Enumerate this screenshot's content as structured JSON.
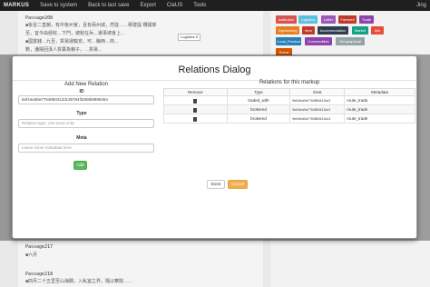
{
  "nav": {
    "brand": "MARKUS",
    "items": [
      "Save to system",
      "Back to last save",
      "Export",
      "ClaUS",
      "Tools"
    ],
    "user": "Jing"
  },
  "background": {
    "passages": [
      {
        "title": "Passage208",
        "text": "■後晉二直朝，有中後州官，且有兩州城，然從……"
      },
      {
        "title": "Passage217",
        "text": "■六月"
      },
      {
        "title": "Passage218",
        "text": "■四月二十五里至山海關，入私室之界，隨以察院……"
      }
    ],
    "lines": [
      "■後晉二直朝，有中後州官，且有兩州城，然從……穆建提 柵開禁",
      "至，宜今由經收…下門，總勢在兵…遣事總會上…",
      "■國賞錢…九至，貿易運輸安，可…縣西…商…",
      "數，潘陽回漢人貿賣為粮子，…貿易…",
      "■二十日，貿易將運隊遷業之東地去…",
      "■東…二…"
    ],
    "popup_label": "Logistics S"
  },
  "tags": [
    {
      "label": "Institution",
      "color": "#d9534f"
    },
    {
      "label": "Logistics",
      "color": "#5bc0de"
    },
    {
      "label": "Letter",
      "color": "#9b59b6"
    },
    {
      "label": "Farewell",
      "color": "#c0392b"
    },
    {
      "label": "Trade",
      "color": "#8e44ad"
    },
    {
      "label": "Sightseeing",
      "color": "#e67e22"
    },
    {
      "label": "Item",
      "color": "#c0392b"
    },
    {
      "label": "Accommodation",
      "color": "#2c3e50"
    },
    {
      "label": "Market",
      "color": "#16a085"
    },
    {
      "label": "Attr",
      "color": "#e74c3c"
    },
    {
      "label": "Local_Product",
      "color": "#2980b9"
    },
    {
      "label": "Commodities",
      "color": "#8e44ad"
    },
    {
      "label": "Geographical",
      "color": "#95a5a6"
    },
    {
      "label": "Event",
      "color": "#d35400"
    }
  ],
  "dialog": {
    "title": "Relations Dialog",
    "add_title": "Add New Relation",
    "id_label": "ID",
    "id_value": "5ef44ed9a7764850412dc35784f3058b8898464",
    "type_label": "Type",
    "type_placeholder": "Relation-type, one word only!",
    "meta_label": "Meta",
    "meta_placeholder": "Leave some metadata here",
    "add_button": "Add",
    "table_title": "Relations for this markup",
    "columns": [
      "Remove",
      "Type",
      "Dest",
      "Metadata"
    ],
    "rows": [
      {
        "type": "traded_with",
        "dest": "5ef44ed9a7764850412dc3",
        "meta": "route_trade"
      },
      {
        "type": "brokered",
        "dest": "5ef44ed9a7764850412dc3",
        "meta": "route_trade"
      },
      {
        "type": "brokered",
        "dest": "5ef44ed9a7764850412dc3",
        "meta": "route_trade"
      }
    ],
    "done_button": "Done",
    "cancel_button": "Cancel"
  }
}
